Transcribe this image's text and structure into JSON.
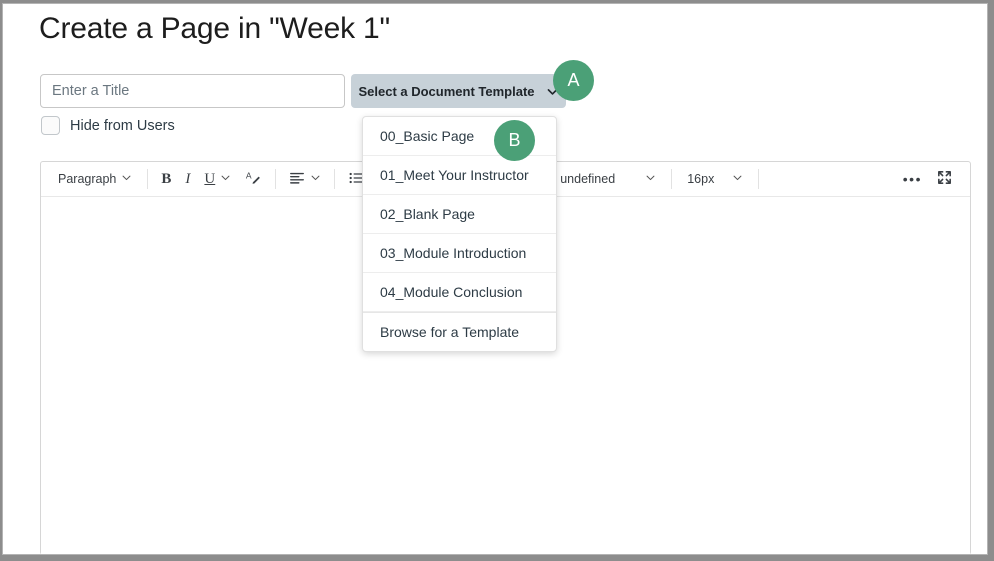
{
  "page": {
    "title": "Create a Page in \"Week 1\""
  },
  "form": {
    "title_input": {
      "value": "",
      "placeholder": "Enter a Title"
    },
    "template_button": {
      "label": "Select a Document Template",
      "icon": "chevron-down-icon"
    },
    "hide_from_users": {
      "label": "Hide from Users",
      "checked": false
    }
  },
  "dropdown": {
    "items": [
      {
        "label": "00_Basic Page"
      },
      {
        "label": "01_Meet Your Instructor"
      },
      {
        "label": "02_Blank Page"
      },
      {
        "label": "03_Module Introduction"
      },
      {
        "label": "04_Module Conclusion"
      },
      {
        "label": "Browse for a Template"
      }
    ]
  },
  "toolbar": {
    "block_format": {
      "label": "Paragraph",
      "icon": "chevron-down-icon"
    },
    "bold": {
      "label": "B",
      "icon": "bold-icon"
    },
    "italic": {
      "label": "I",
      "icon": "italic-icon"
    },
    "underline": {
      "label": "U",
      "icon": "underline-icon"
    },
    "text_color": {
      "icon": "text-color-icon"
    },
    "align": {
      "icon": "align-left-icon"
    },
    "table": {
      "icon": "insert-table-icon"
    },
    "insert": {
      "icon": "plus-icon"
    },
    "font_family": {
      "label": "undefined",
      "icon": "chevron-down-icon"
    },
    "font_size": {
      "label": "16px",
      "icon": "chevron-down-icon"
    },
    "more": {
      "label": "•••",
      "icon": "more-options-icon"
    },
    "fullscreen": {
      "icon": "fullscreen-icon"
    }
  },
  "editor": {
    "content": ""
  },
  "annotations": {
    "badge_a": {
      "label": "A",
      "color": "#4ba077"
    },
    "badge_b": {
      "label": "B",
      "color": "#4ba077"
    }
  }
}
